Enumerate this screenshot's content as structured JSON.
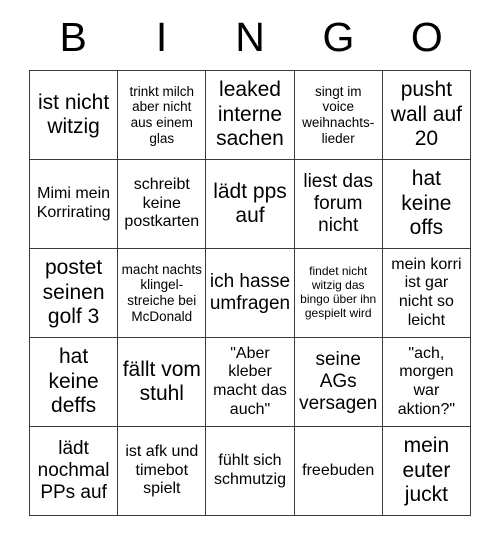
{
  "header": {
    "letters": [
      "B",
      "I",
      "N",
      "G",
      "O"
    ]
  },
  "grid": {
    "rows": 5,
    "columns": 5,
    "border_color": "#3a3a3a",
    "background": "#ffffff",
    "text_color": "#000000"
  },
  "cells": [
    {
      "text": "ist nicht witzig",
      "size": "fs-xl"
    },
    {
      "text": "trinkt milch aber nicht aus einem glas",
      "size": "fs-sm"
    },
    {
      "text": "leaked interne sachen",
      "size": "fs-xl"
    },
    {
      "text": "singt im voice weihnachts- lieder",
      "size": "fs-sm"
    },
    {
      "text": "pusht wall auf 20",
      "size": "fs-xl"
    },
    {
      "text": "Mimi mein Korrirating",
      "size": "fs-md"
    },
    {
      "text": "schreibt keine postkarten",
      "size": "fs-md"
    },
    {
      "text": "lädt pps auf",
      "size": "fs-xl"
    },
    {
      "text": "liest das forum nicht",
      "size": "fs-lg"
    },
    {
      "text": "hat keine offs",
      "size": "fs-xl"
    },
    {
      "text": "postet seinen golf 3",
      "size": "fs-xl"
    },
    {
      "text": "macht nachts klingel- streiche bei McDonald",
      "size": "fs-sm"
    },
    {
      "text": "ich hasse umfragen",
      "size": "fs-lg"
    },
    {
      "text": "findet nicht witzig das bingo über ihn gespielt wird",
      "size": "fs-xs"
    },
    {
      "text": "mein korri ist gar nicht so leicht",
      "size": "fs-md"
    },
    {
      "text": "hat keine deffs",
      "size": "fs-xl"
    },
    {
      "text": "fällt vom stuhl",
      "size": "fs-xl"
    },
    {
      "text": "\"Aber kleber macht das auch\"",
      "size": "fs-md"
    },
    {
      "text": "seine AGs versagen",
      "size": "fs-lg"
    },
    {
      "text": "\"ach, morgen war aktion?\"",
      "size": "fs-md"
    },
    {
      "text": "lädt nochmal PPs auf",
      "size": "fs-lg"
    },
    {
      "text": "ist afk und timebot spielt",
      "size": "fs-md"
    },
    {
      "text": "fühlt sich schmutzig",
      "size": "fs-md"
    },
    {
      "text": "freebuden",
      "size": "fs-md"
    },
    {
      "text": "mein euter juckt",
      "size": "fs-xl"
    }
  ]
}
